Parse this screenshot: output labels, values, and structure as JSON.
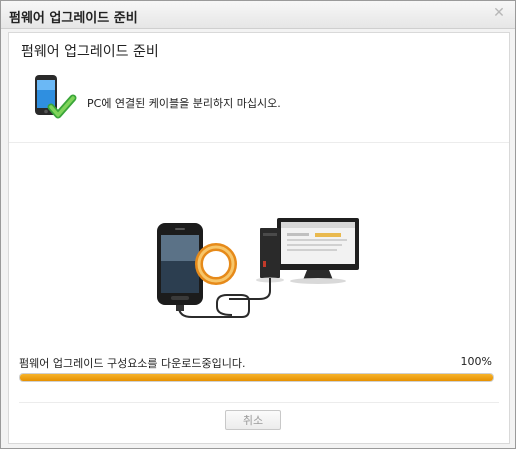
{
  "window": {
    "title": "펌웨어 업그레이드 준비",
    "close_glyph": "✕"
  },
  "panel": {
    "heading": "펌웨어 업그레이드 준비",
    "instruction": "PC에 연결된 케이블을 분리하지 마십시오.",
    "icon": "phone-check-icon"
  },
  "progress": {
    "status": "펌웨어 업그레이드 구성요소를 다운로드중입니다.",
    "percent_label": "100%",
    "value": 1.0,
    "fill_color": "#f0a010"
  },
  "footer": {
    "cancel_label": "취소",
    "cancel_enabled": false
  }
}
